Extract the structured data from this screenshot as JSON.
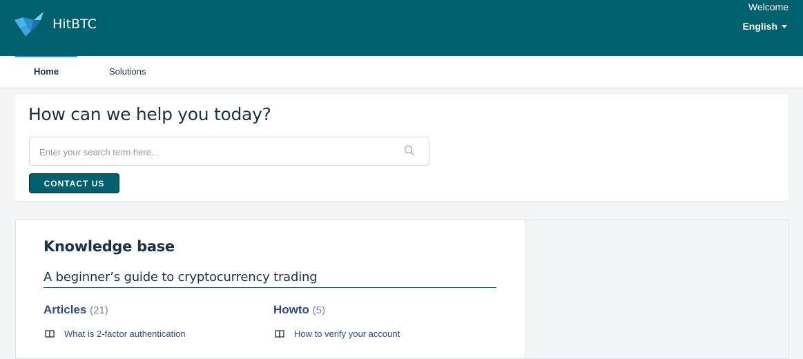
{
  "header": {
    "brand": "HitBTC",
    "welcome": "Welcome",
    "language": "English",
    "brand_color": "#00606e"
  },
  "nav": {
    "tabs": [
      {
        "label": "Home",
        "active": true
      },
      {
        "label": "Solutions",
        "active": false
      }
    ]
  },
  "hero": {
    "title": "How can we help you today?",
    "search_placeholder": "Enter your search term here...",
    "contact_label": "CONTACT US"
  },
  "knowledge_base": {
    "title": "Knowledge base",
    "category": "A beginner’s guide to cryptocurrency trading",
    "folders": [
      {
        "name": "Articles",
        "count": "(21)",
        "first_article": "What is 2-factor authentication"
      },
      {
        "name": "Howto",
        "count": "(5)",
        "first_article": "How to verify your account"
      }
    ]
  },
  "icons": [
    "logo-icon",
    "search-icon",
    "caret-down-icon",
    "book-icon"
  ]
}
